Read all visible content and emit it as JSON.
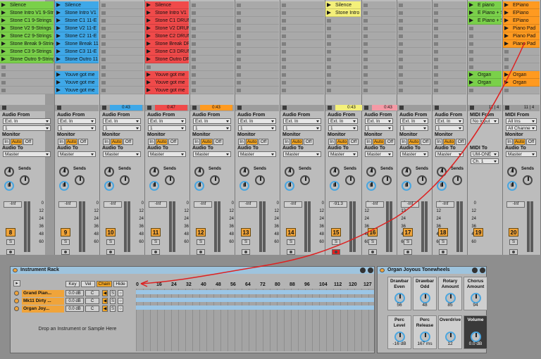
{
  "colors": {
    "green": "#7ad04a",
    "blue": "#3fa8e8",
    "red": "#f04a4a",
    "orange": "#ff9a20",
    "yellow": "#f4f07a",
    "accent": "#f5a623",
    "pink": "#f49aa6"
  },
  "tracks": [
    {
      "clips": [
        {
          "row": 0,
          "text": "Silence",
          "color": "green"
        },
        {
          "row": 1,
          "text": "Stone Intro V1 9-Strings",
          "color": "green"
        },
        {
          "row": 2,
          "text": "Stone C1 9-Strings",
          "color": "green"
        },
        {
          "row": 3,
          "text": "Stone V2 9-Strings",
          "color": "green"
        },
        {
          "row": 4,
          "text": "Stone C2 9-Strings",
          "color": "green"
        },
        {
          "row": 5,
          "text": "Stone Break 9-Strings",
          "color": "green"
        },
        {
          "row": 6,
          "text": "Stone C3 9-Strings",
          "color": "green"
        },
        {
          "row": 7,
          "text": "Stone Outro 9-Strings",
          "color": "green"
        }
      ],
      "time": "",
      "io": {
        "from": "Ext. In",
        "ch": "1",
        "to": "Master"
      },
      "vol": "-Inf",
      "num": "8",
      "sends": true
    },
    {
      "clips": [
        {
          "row": 0,
          "text": "Silence",
          "color": "blue"
        },
        {
          "row": 1,
          "text": "Stone Intro V1",
          "color": "blue"
        },
        {
          "row": 2,
          "text": "Stone C1 11-E",
          "color": "blue"
        },
        {
          "row": 3,
          "text": "Stone V2 11-E",
          "color": "blue"
        },
        {
          "row": 4,
          "text": "Stone C2 11-E",
          "color": "blue"
        },
        {
          "row": 5,
          "text": "Stone Break 11",
          "color": "blue"
        },
        {
          "row": 6,
          "text": "Stone C3 11-E",
          "color": "blue"
        },
        {
          "row": 7,
          "text": "Stone Outro 11",
          "color": "blue"
        },
        {
          "row": 9,
          "text": "Youve got me",
          "color": "blue"
        },
        {
          "row": 10,
          "text": "Youve got me",
          "color": "blue"
        },
        {
          "row": 11,
          "text": "Youve got me",
          "color": "blue"
        }
      ],
      "time": "",
      "io": {
        "from": "Ext. In",
        "ch": "1",
        "to": "Master"
      },
      "vol": "-Inf",
      "num": "9",
      "sends": true
    },
    {
      "clips": [],
      "time": "0:43",
      "io": {
        "from": "Ext. In",
        "ch": "1",
        "to": "Master"
      },
      "vol": "-Inf",
      "num": "10",
      "sends": true
    },
    {
      "clips": [
        {
          "row": 0,
          "text": "Silence",
          "color": "red"
        },
        {
          "row": 1,
          "text": "Stone Intro V1",
          "color": "red"
        },
        {
          "row": 2,
          "text": "Stone C1 DRUM",
          "color": "red"
        },
        {
          "row": 3,
          "text": "Stone V2 DRUM",
          "color": "red"
        },
        {
          "row": 4,
          "text": "Stone C2 DRUM",
          "color": "red"
        },
        {
          "row": 5,
          "text": "Stone Break DR",
          "color": "red"
        },
        {
          "row": 6,
          "text": "Stone C3 DRUM",
          "color": "red"
        },
        {
          "row": 7,
          "text": "Stone Outro DR",
          "color": "red"
        },
        {
          "row": 9,
          "text": "Youve got me",
          "color": "red"
        },
        {
          "row": 10,
          "text": "Youve got me",
          "color": "red"
        },
        {
          "row": 11,
          "text": "Youve got me",
          "color": "red"
        }
      ],
      "time": "0:47",
      "io": {
        "from": "Ext. In",
        "ch": "1",
        "to": "Master"
      },
      "vol": "-Inf",
      "num": "11",
      "sends": true
    },
    {
      "clips": [],
      "time": "0:43",
      "io": {
        "from": "Ext. In",
        "ch": "1",
        "to": "Master"
      },
      "vol": "-Inf",
      "num": "12",
      "sends": true
    },
    {
      "clips": [],
      "time": "",
      "io": {
        "from": "Ext. In",
        "ch": "1",
        "to": "Master"
      },
      "vol": "-Inf",
      "num": "13",
      "sends": true
    },
    {
      "clips": [],
      "time": "",
      "io": {
        "from": "Ext. In",
        "ch": "1",
        "to": "Master"
      },
      "vol": "-Inf",
      "num": "14",
      "sends": true
    },
    {
      "clips": [
        {
          "row": 0,
          "text": "Silence",
          "color": "yellow"
        },
        {
          "row": 1,
          "text": "Stone Intro",
          "color": "yellow"
        }
      ],
      "time": "0:43",
      "io": {
        "from": "Ext. In",
        "ch": "1",
        "to": "Master"
      },
      "vol": "-91.3",
      "num": "15",
      "sends": true,
      "rec": true
    },
    {
      "clips": [],
      "time": "0:43",
      "io": {
        "from": "Ext. In",
        "ch": "1",
        "to": "Master"
      },
      "vol": "-Inf",
      "num": "16",
      "sends": true
    },
    {
      "clips": [],
      "time": "",
      "io": {
        "from": "Ext. In",
        "ch": "1",
        "to": "Master"
      },
      "vol": "-Inf",
      "num": "17",
      "sends": true
    },
    {
      "clips": [],
      "time": "",
      "io": {
        "from": "Ext. In",
        "ch": "1",
        "to": "Master"
      },
      "vol": "-Inf",
      "num": "18",
      "sends": true
    },
    {
      "clips": [
        {
          "row": 0,
          "text": "E piano",
          "color": "green"
        },
        {
          "row": 1,
          "text": "E Piano + Str",
          "color": "green"
        },
        {
          "row": 2,
          "text": "E Piano + Str",
          "color": "green"
        },
        {
          "row": 9,
          "text": "Organ",
          "color": "green"
        },
        {
          "row": 10,
          "text": "Organ",
          "color": "green"
        }
      ],
      "time": "11 | 4",
      "io": {
        "from": "No Input",
        "ch": "",
        "to": "UM-ONE",
        "midi": true,
        "midich": "Ch. 1"
      },
      "vol": "",
      "num": "19",
      "sends": false
    },
    {
      "clips": [
        {
          "row": 0,
          "text": "EPiano",
          "color": "orange"
        },
        {
          "row": 1,
          "text": "EPiano",
          "color": "orange"
        },
        {
          "row": 2,
          "text": "EPiano",
          "color": "orange"
        },
        {
          "row": 3,
          "text": "Piano Pad",
          "color": "orange"
        },
        {
          "row": 4,
          "text": "Piano Pad",
          "color": "orange"
        },
        {
          "row": 5,
          "text": "Piano Pad",
          "color": "orange"
        },
        {
          "row": 9,
          "text": "Organ",
          "color": "orange"
        },
        {
          "row": 10,
          "text": "Organ",
          "color": "orange"
        }
      ],
      "time": "11 | 4",
      "io": {
        "from": "All Ins",
        "ch": "All Channe",
        "to": "Master",
        "midifrom": true
      },
      "vol": "-Inf",
      "num": "20",
      "sends": true
    }
  ],
  "labels": {
    "audio_from": "Audio From",
    "midi_from": "MIDI From",
    "monitor": "Monitor",
    "audio_to": "Audio To",
    "midi_to": "MIDI To",
    "in": "In",
    "auto": "Auto",
    "off": "Off",
    "sends": "Sends",
    "s": "S",
    "a": "A",
    "b": "B"
  },
  "scale": [
    "0",
    "12",
    "24",
    "36",
    "48",
    "60"
  ],
  "rack": {
    "title": "Instrument Rack",
    "key": "Key",
    "vel": "Vel",
    "chain": "Chain",
    "hide": "Hide",
    "drop": "Drop an Instrument or Sample Here",
    "chains": [
      {
        "name": "Grand Pian...",
        "vol": "0.0 dB",
        "pan": "C"
      },
      {
        "name": "Mk11 Dirty ...",
        "vol": "0.0 dB",
        "pan": "C"
      },
      {
        "name": "Organ Joy...",
        "vol": "0.0 dB",
        "pan": "C"
      }
    ],
    "ruler": [
      "0",
      "16",
      "24",
      "32",
      "40",
      "48",
      "56",
      "64",
      "72",
      "80",
      "88",
      "96",
      "104",
      "112",
      "120",
      "127"
    ]
  },
  "organ": {
    "title": "Organ Joyous Tonewheels",
    "macros": [
      {
        "label": "Drawbar Even",
        "value": "56"
      },
      {
        "label": "Drawbar Odd",
        "value": "48"
      },
      {
        "label": "Rotary Amount",
        "value": "85"
      },
      {
        "label": "Chorus Amount",
        "value": "94"
      },
      {
        "label": "Perc Level",
        "value": "-16 dB"
      },
      {
        "label": "Perc Release",
        "value": "167 ms"
      },
      {
        "label": "Overdrive",
        "value": "12"
      },
      {
        "label": "Volume",
        "value": "0.0 dB"
      }
    ]
  }
}
